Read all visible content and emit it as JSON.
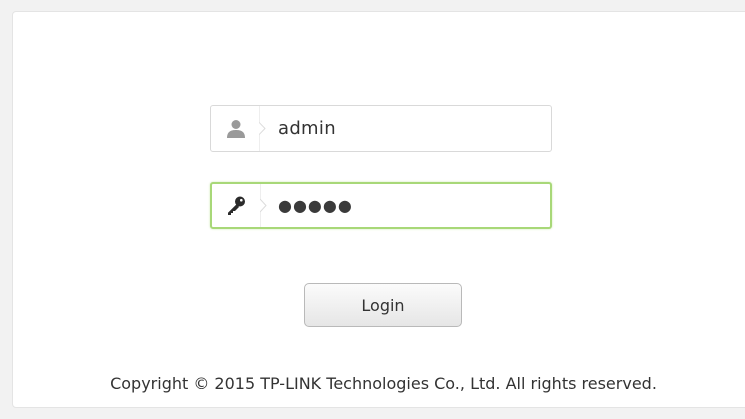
{
  "login_form": {
    "username_value": "admin",
    "password_value": "●●●●●",
    "login_label": "Login",
    "username_icon": "user-icon",
    "password_icon": "key-icon",
    "focus_border_color": "#a8d878"
  },
  "footer": {
    "copyright": "Copyright © 2015 TP-LINK Technologies Co., Ltd. All rights reserved."
  }
}
